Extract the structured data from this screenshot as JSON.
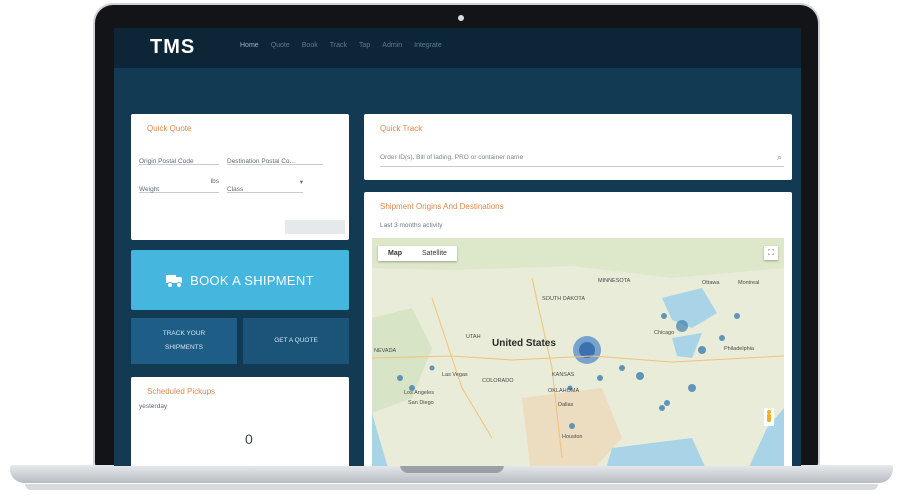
{
  "app": {
    "brand": "TMS"
  },
  "nav": {
    "items": [
      {
        "label": "Home",
        "active": true
      },
      {
        "label": "Quote",
        "active": false
      },
      {
        "label": "Book",
        "active": false
      },
      {
        "label": "Track",
        "active": false
      },
      {
        "label": "Tap",
        "active": false
      },
      {
        "label": "Admin",
        "active": false
      },
      {
        "label": "Integrate",
        "active": false
      }
    ]
  },
  "quick_quote": {
    "title": "Quick Quote",
    "origin_placeholder": "Origin Postal Code",
    "destination_placeholder": "Destination Postal Co...",
    "weight_placeholder": "Weight",
    "weight_unit": "lbs",
    "class_value": "Class",
    "get_rates_label": ""
  },
  "quick_track": {
    "title": "Quick Track",
    "search_placeholder": "Order ID(s), Bill of lading, PRO or container name"
  },
  "book_shipment": {
    "label": "BOOK A SHIPMENT"
  },
  "track": {
    "line1": "TRACK YOUR",
    "line2": "SHIPMENTS"
  },
  "quote": {
    "label": "GET A QUOTE"
  },
  "pickups": {
    "title": "Scheduled Pickups",
    "subtitle": "yesterday",
    "count": "0"
  },
  "map_card": {
    "title": "Shipment Origins And Destinations",
    "subtitle": "Last 3 months activity",
    "tabs": [
      "Map",
      "Satellite"
    ],
    "country_label": "United States",
    "place_labels": [
      "NEVADA",
      "Las Vegas",
      "Los Angeles",
      "San Diego",
      "Dallas",
      "Houston",
      "Chicago",
      "Ottawa",
      "Montreal",
      "Philadelphia",
      "UTAH",
      "COLORADO",
      "KANSAS",
      "OKLAHOMA",
      "SOUTH DAKOTA",
      "MINNESOTA"
    ]
  },
  "colors": {
    "accent_orange": "#e0894b",
    "book_button": "#45b6dd",
    "dark_button": "#1e5d86",
    "nav_bg": "#0c2637",
    "app_bg": "#123a52"
  },
  "icons": [
    "truck-icon",
    "search-icon",
    "fullscreen-icon",
    "pegman-icon",
    "chevron-down-icon"
  ]
}
